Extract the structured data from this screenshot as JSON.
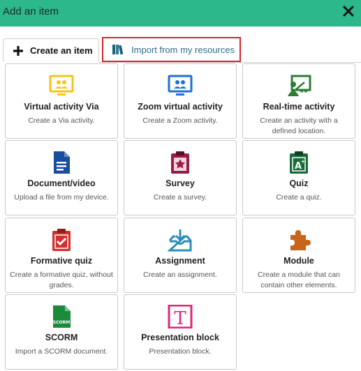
{
  "header": {
    "title": "Add an item"
  },
  "tabs": {
    "create_label": "Create an item",
    "import_label": "Import from my resources"
  },
  "items": [
    {
      "name": "Virtual activity Via",
      "desc": "Create a Via activity."
    },
    {
      "name": "Zoom virtual activity",
      "desc": "Create a Zoom activity."
    },
    {
      "name": "Real-time activity",
      "desc": "Create an activity with a defined location."
    },
    {
      "name": "Document/video",
      "desc": "Upload a file from my device."
    },
    {
      "name": "Survey",
      "desc": "Create a survey."
    },
    {
      "name": "Quiz",
      "desc": "Create a quiz."
    },
    {
      "name": "Formative quiz",
      "desc": "Create a formative quiz, without grades."
    },
    {
      "name": "Assignment",
      "desc": "Create an assignment."
    },
    {
      "name": "Module",
      "desc": "Create a module that can contain other elements."
    },
    {
      "name": "SCORM",
      "desc": "Import a SCORM document.",
      "icon_text": "SCORM"
    },
    {
      "name": "Presentation block",
      "desc": "Presentation block.",
      "icon_text": "T"
    }
  ],
  "colors": {
    "header": "#2cb88a",
    "via": "#f5c518",
    "zoom": "#1e6fd9",
    "realtime": "#2e7d32",
    "document": "#1a4d9e",
    "survey": "#9b1b45",
    "quiz": "#1b6b3a",
    "formative": "#d32f2f",
    "assignment": "#2a8fb8",
    "module": "#c8651b",
    "scorm": "#1b8a3a",
    "presentation": "#e0267a",
    "highlight": "#d9262c"
  }
}
